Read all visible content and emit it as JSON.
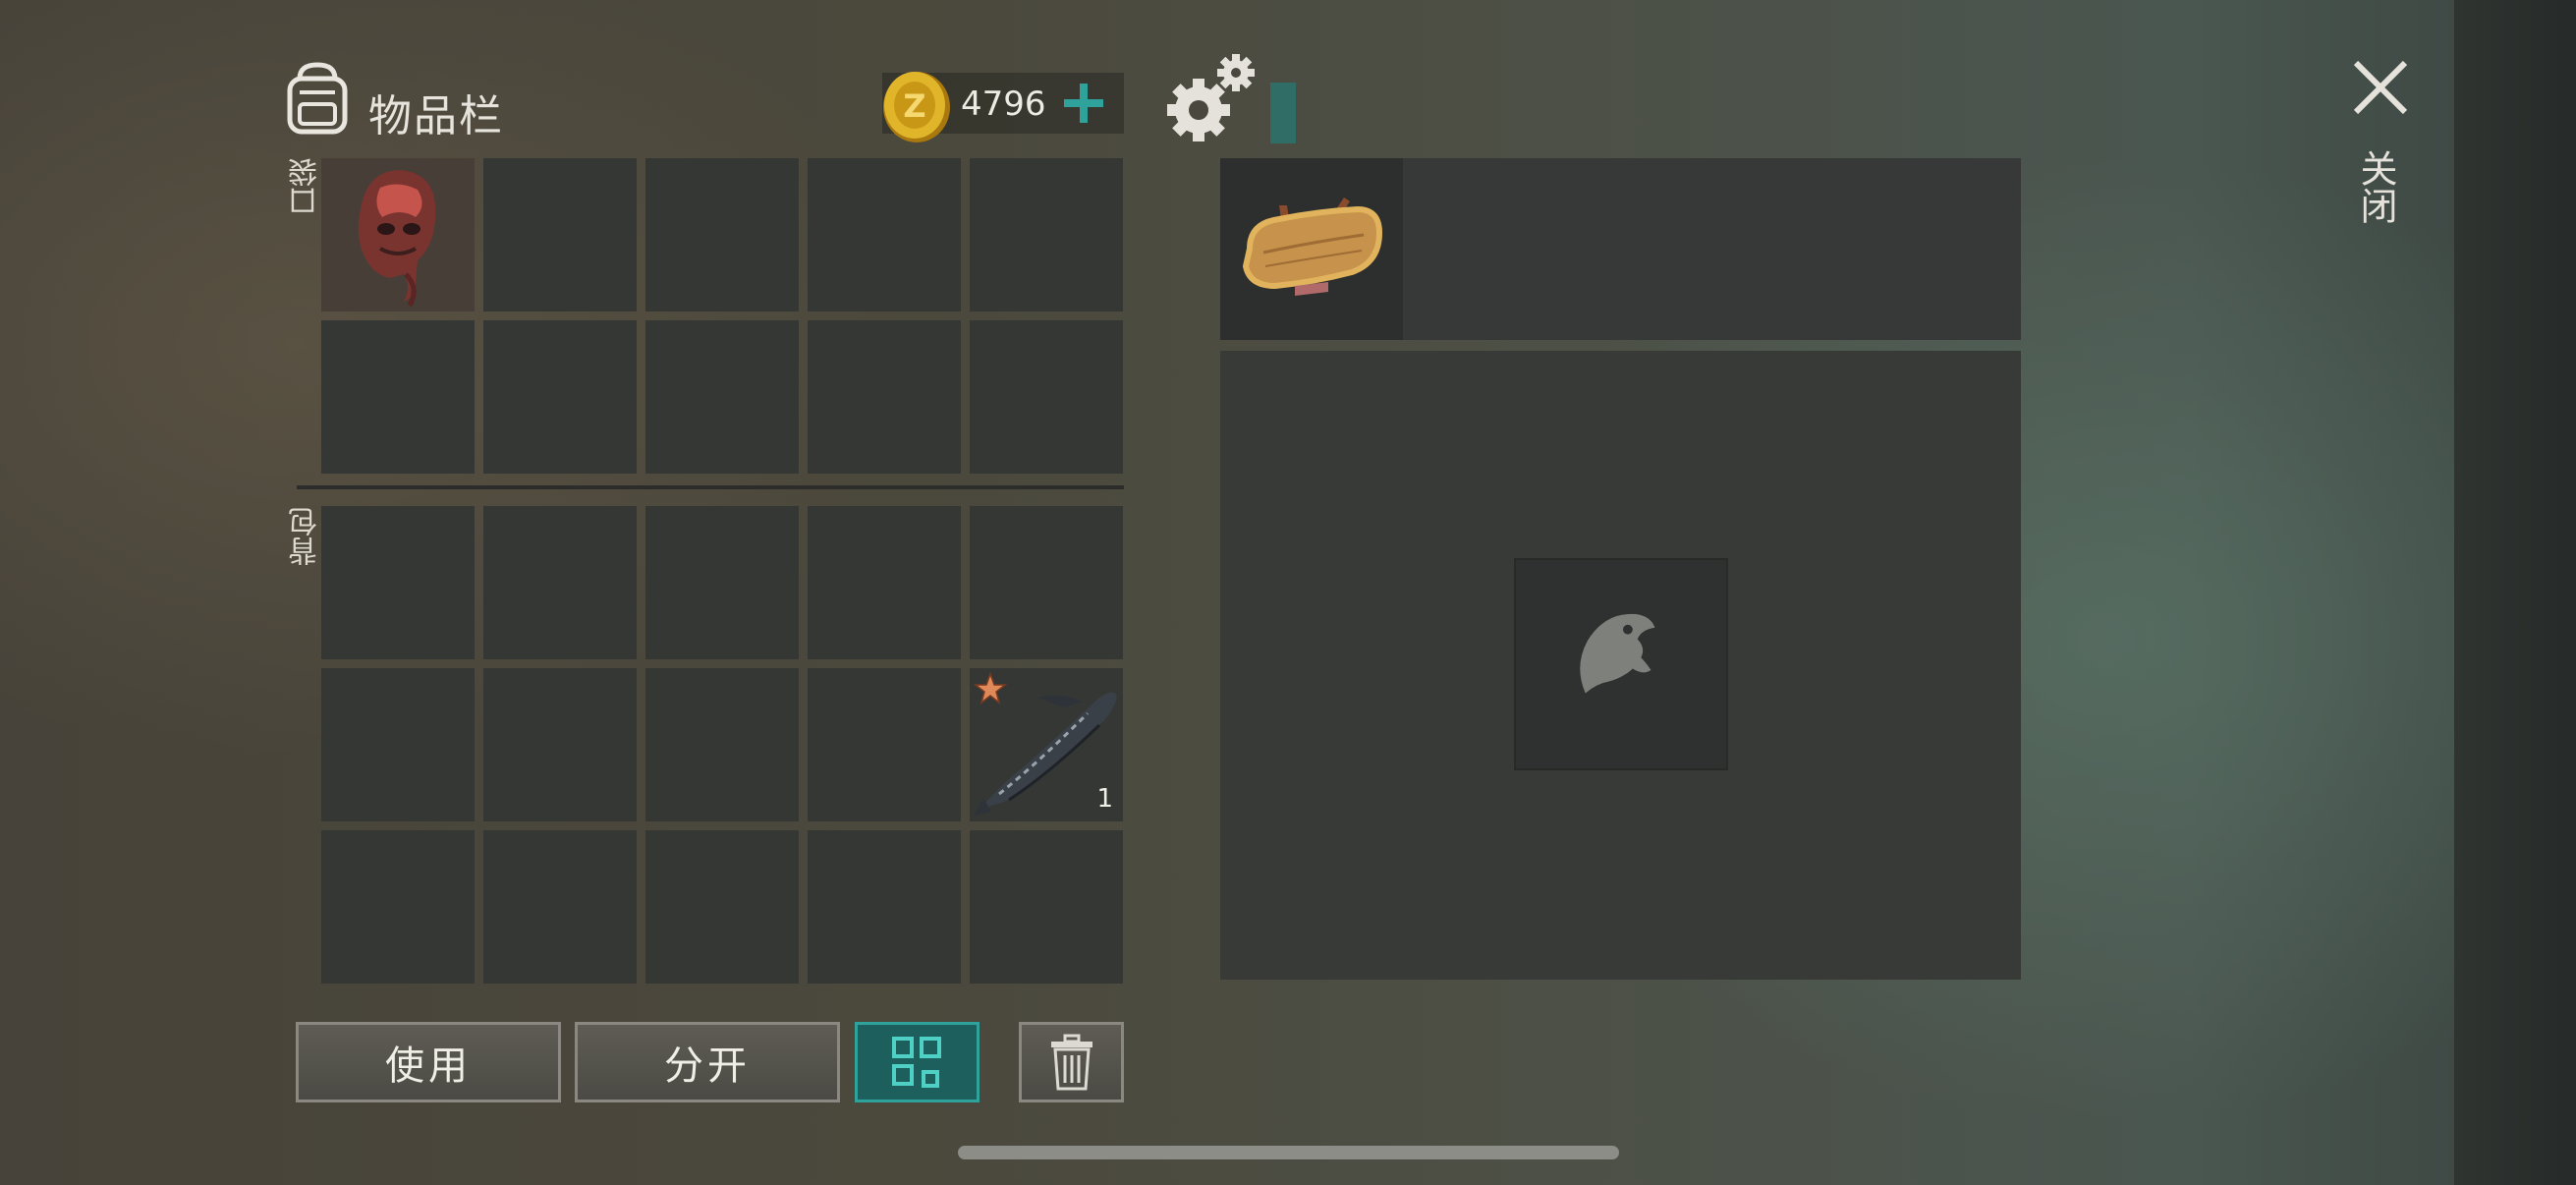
{
  "header": {
    "title": "物品栏",
    "coins": "4796",
    "accent_color": "#2fa39b"
  },
  "close": {
    "label": "关闭"
  },
  "inventory": {
    "pocket_label": "口袋",
    "backpack_label": "背包",
    "pocket_slots": [
      {
        "item": "mutant-head-icon"
      },
      {},
      {},
      {},
      {},
      {},
      {},
      {},
      {},
      {}
    ],
    "backpack_slots": [
      {},
      {},
      {},
      {},
      {},
      {},
      {},
      {},
      {},
      {
        "item": "sturgeon-fish-icon",
        "quantity": "1",
        "starred": true
      },
      {},
      {},
      {},
      {},
      {}
    ]
  },
  "container": {
    "top_slot_item": "wooden-sign-icon",
    "main_slot_icon": "fish-icon"
  },
  "actions": {
    "use_label": "使用",
    "split_label": "分开"
  }
}
